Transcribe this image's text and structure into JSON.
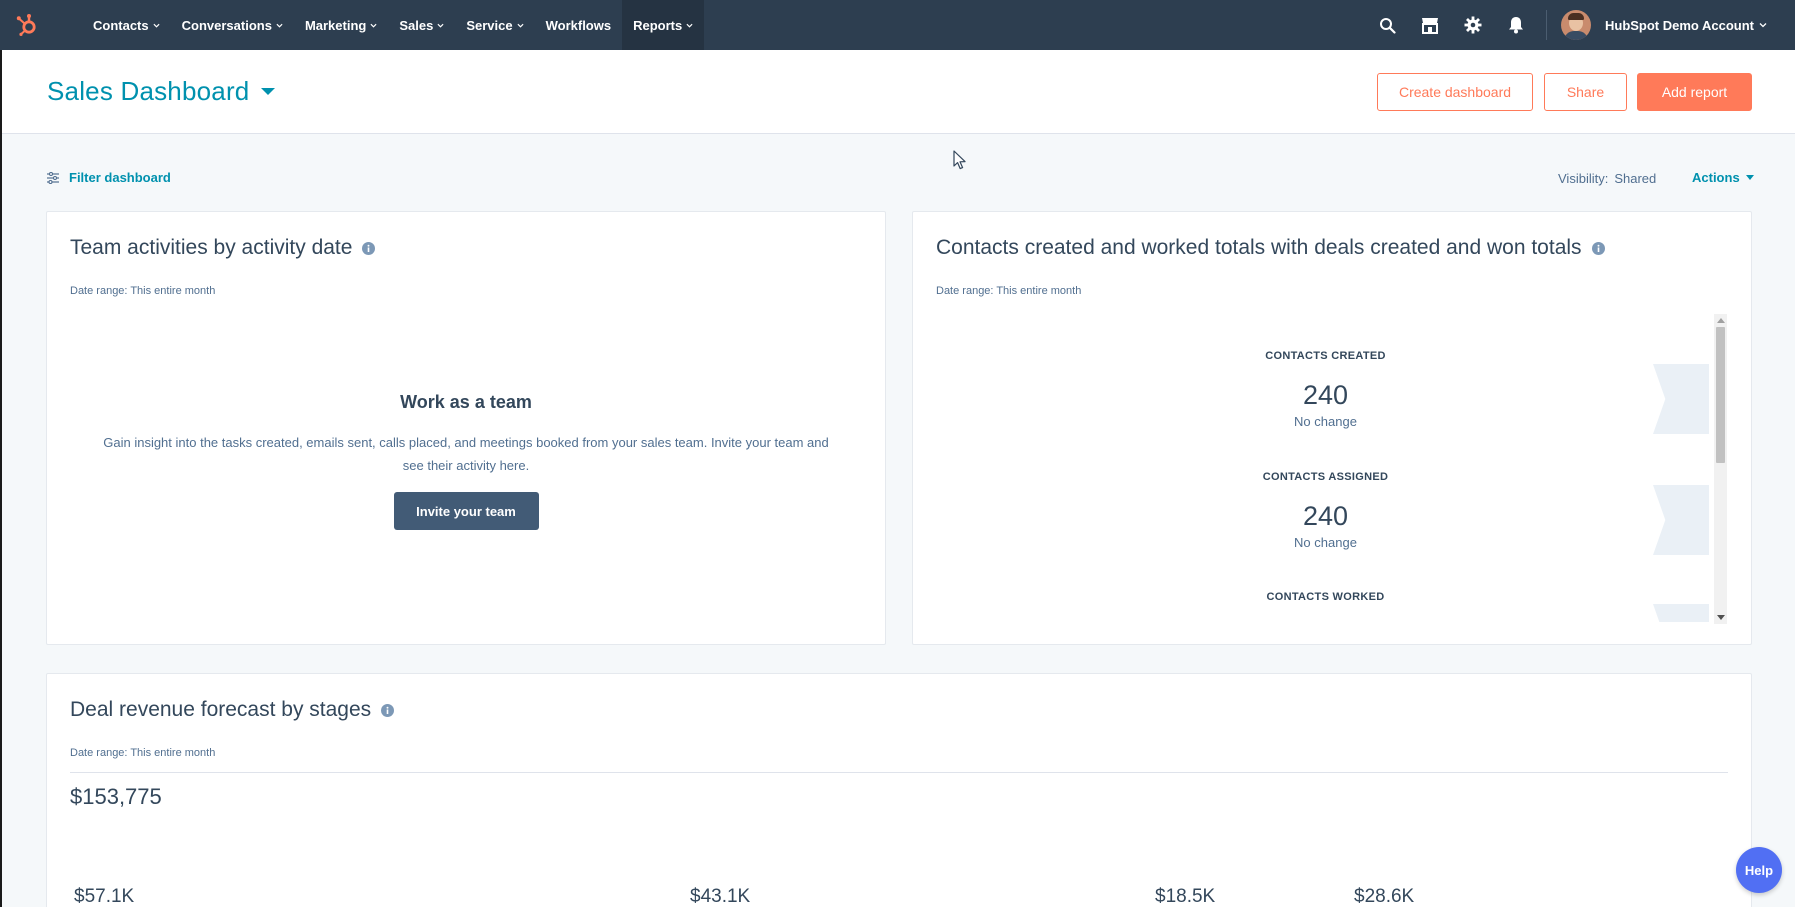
{
  "nav": {
    "items": [
      {
        "label": "Contacts",
        "has_menu": true
      },
      {
        "label": "Conversations",
        "has_menu": true
      },
      {
        "label": "Marketing",
        "has_menu": true
      },
      {
        "label": "Sales",
        "has_menu": true
      },
      {
        "label": "Service",
        "has_menu": true
      },
      {
        "label": "Workflows",
        "has_menu": false
      },
      {
        "label": "Reports",
        "has_menu": true,
        "active": true
      }
    ],
    "icons": [
      "search-icon",
      "marketplace-icon",
      "settings-icon",
      "notifications-icon"
    ],
    "account_name": "HubSpot Demo Account"
  },
  "header": {
    "title": "Sales Dashboard",
    "create_dashboard": "Create dashboard",
    "share": "Share",
    "add_report": "Add report"
  },
  "toolbar": {
    "filter_label": "Filter dashboard",
    "visibility_label": "Visibility:",
    "visibility_value": "Shared",
    "actions_label": "Actions"
  },
  "cards": {
    "team": {
      "title": "Team activities by activity date",
      "date_range": "Date range:  This entire month",
      "empty_title": "Work as a team",
      "empty_desc": "Gain insight into the tasks created, emails sent, calls placed, and meetings booked from your sales team. Invite your team and see their activity here.",
      "invite_button": "Invite your team"
    },
    "contacts": {
      "title": "Contacts created and worked totals with deals created and won totals",
      "date_range": "Date range:  This entire month",
      "kpis": [
        {
          "label": "CONTACTS CREATED",
          "value": "240",
          "change": "No change"
        },
        {
          "label": "CONTACTS ASSIGNED",
          "value": "240",
          "change": "No change"
        },
        {
          "label": "CONTACTS WORKED",
          "value": "",
          "change": ""
        }
      ]
    },
    "revenue": {
      "title": "Deal revenue forecast by stages",
      "date_range": "Date range:  This entire month",
      "total": "$153,775",
      "stage_values": [
        "$57.1K",
        "$43.1K",
        "$18.5K",
        "$28.6K"
      ]
    }
  },
  "help": {
    "label": "Help"
  },
  "colors": {
    "nav_bg": "#2d3e50",
    "accent_orange": "#ff7a59",
    "link_teal": "#0091ae",
    "text_dark": "#33475b"
  }
}
